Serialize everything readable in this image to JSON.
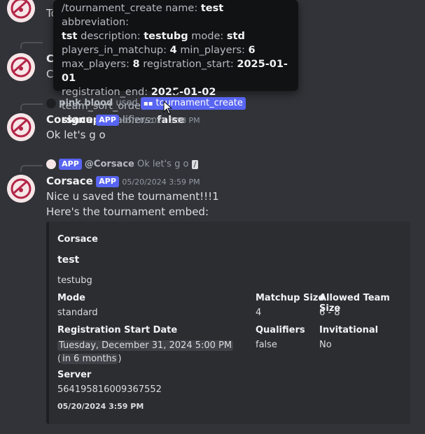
{
  "top": {
    "partial_name": "C",
    "partial_text": "To",
    "second_name": "C",
    "second_text": "C"
  },
  "tooltip": {
    "command": "/tournament_create",
    "params": [
      {
        "k": "name:",
        "v": "test"
      },
      {
        "k": "abbreviation:",
        "v": "tst"
      },
      {
        "k": "description:",
        "v": "testubg"
      },
      {
        "k": "mode:",
        "v": "std"
      },
      {
        "k": "players_in_matchup:",
        "v": "4"
      },
      {
        "k": "min_players:",
        "v": "6"
      },
      {
        "k": "max_players:",
        "v": "8"
      },
      {
        "k": "registration_start:",
        "v": "2025-01-01"
      },
      {
        "k": "registration_end:",
        "v": "2025-01-02"
      },
      {
        "k": "team_sort_order:",
        "v": "signup"
      },
      {
        "k": "qualifiers:",
        "v": "false"
      }
    ]
  },
  "msg1": {
    "reply_user": "pink blood",
    "reply_used": "used",
    "reply_command": "tournament_create",
    "author": "Corsace",
    "badge": "APP",
    "timestamp": "05/20/2024 3:58 PM",
    "text": "Ok let's g o"
  },
  "msg2": {
    "reply_badge": "APP",
    "reply_user": "@Corsace",
    "reply_text": "Ok let's g o",
    "author": "Corsace",
    "badge": "APP",
    "timestamp": "05/20/2024 3:59 PM",
    "line1": "Nice u saved the tournament!!!1",
    "line2": "Here's the tournament embed:"
  },
  "embed": {
    "author": "Corsace",
    "title": "test",
    "description": "testubg",
    "fields": {
      "mode_name": "Mode",
      "mode_value": "standard",
      "matchup_name": "Matchup Size",
      "matchup_value": "4",
      "team_name": "Allowed Team Size",
      "team_value": "6 - 8",
      "reg_name": "Registration Start Date",
      "reg_ts": "Tuesday, December 31, 2024 5:00 PM",
      "reg_rel_open": "(",
      "reg_rel": "in 6 months",
      "reg_rel_close": ")",
      "qual_name": "Qualifiers",
      "qual_value": "false",
      "inv_name": "Invitational",
      "inv_value": "No",
      "server_name": "Server",
      "server_value": "564195816009367552"
    },
    "footer": "05/20/2024 3:59 PM"
  },
  "colors": {
    "background": "#313338",
    "embed_bg": "#2b2d31",
    "blurple": "#5865f2",
    "tooltip_bg": "#111214"
  },
  "icons": [
    "corsace-logo-icon",
    "slash-command-icon",
    "edited-icon",
    "mouse-cursor-icon"
  ]
}
